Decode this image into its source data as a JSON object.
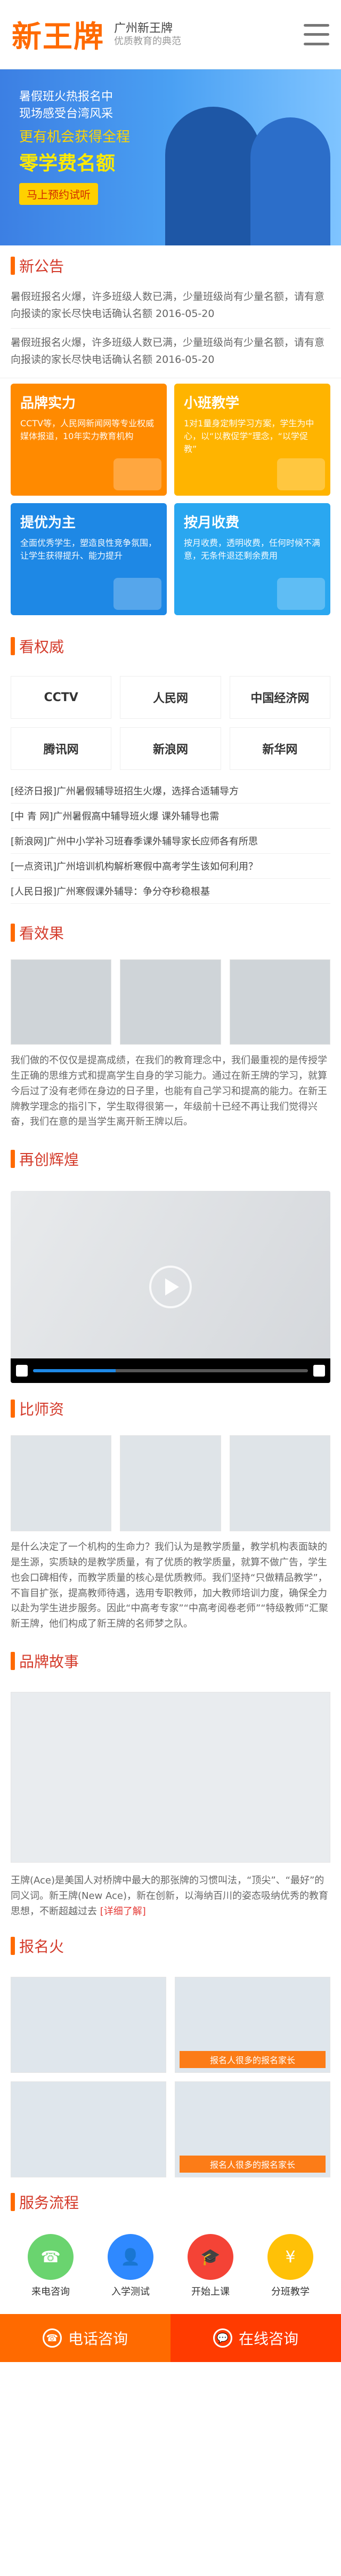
{
  "header": {
    "logo_main": "新王牌",
    "logo_line1": "广州新王牌",
    "logo_line2": "优质教育的典范"
  },
  "banner": {
    "line1": "暑假班火热报名中",
    "line2": "现场感受台湾风采",
    "line3": "更有机会获得全程",
    "headline": "零学费名额",
    "cta": "马上预约试听"
  },
  "notice": {
    "title": "新公告",
    "items": [
      "暑假班报名火爆，许多班级人数已满，少量班级尚有少量名额，请有意向报读的家长尽快电话确认名额   2016-05-20",
      "暑假班报名火爆，许多班级人数已满，少量班级尚有少量名额，请有意向报读的家长尽快电话确认名额   2016-05-20"
    ]
  },
  "features": [
    {
      "title": "品牌实力",
      "desc": "CCTV等，人民网新闻网等专业权威媒体报道，10年实力教育机构",
      "color": "orange"
    },
    {
      "title": "小班教学",
      "desc": "1对1量身定制学习方案，学生为中心，以“以教促学”理念，“以学促教”",
      "color": "yellow"
    },
    {
      "title": "提优为主",
      "desc": "全面优秀学生，塑造良性竞争氛围，让学生获得提升、能力提升",
      "color": "blue"
    },
    {
      "title": "按月收费",
      "desc": "按月收费，透明收费，任何时候不满意，无条件退还剩余费用",
      "color": "lblue"
    }
  ],
  "authority": {
    "title": "看权威",
    "logos": [
      "CCTV",
      "人民网",
      "中国经济网",
      "腾讯网",
      "新浪网",
      "新华网"
    ],
    "news": [
      "[经济日报]广州暑假辅导班招生火爆，选择合适辅导方",
      "[中 青 网]广州暑假高中辅导班火爆 课外辅导也需",
      "[新浪网]广州中小学补习班春季课外辅导家长应师各有所思",
      "[一点资讯]广州培训机构解析寒假中高考学生该如何利用？",
      "[人民日报]广州寒假课外辅导：争分夺秒稳根基"
    ]
  },
  "effect": {
    "title": "看效果",
    "desc": "我们做的不仅仅是提高成绩，在我们的教育理念中，我们最重视的是传授学生正确的思维方式和提高学生自身的学习能力。通过在新王牌的学习，就算今后过了没有老师在身边的日子里，也能有自己学习和提高的能力。在新王牌教学理念的指引下，学生取得很第一，年级前十已经不再让我们觉得兴奋，我们在意的是当学生离开新王牌以后。"
  },
  "video": {
    "title": "再创辉煌"
  },
  "teachers": {
    "title": "比师资",
    "desc": "是什么决定了一个机构的生命力？我们认为是教学质量，教学机构表面缺的是生源，实质缺的是教学质量，有了优质的教学质量，就算不做广告，学生也会口碑相传，而教学质量的核心是优质教师。我们坚持“只做精品教学”，不盲目扩张，提高教师待遇，选用专职教师，加大教师培训力度，确保全力以赴为学生进步服务。因此“中高考专家”“中高考阅卷老师”“特级教师”汇聚新王牌，他们构成了新王牌的名师梦之队。"
  },
  "story": {
    "title": "品牌故事",
    "text": "王牌(Ace)是美国人对桥牌中最大的那张牌的习惯叫法，“顶尖”、“最好”的同义词。新王牌(New Ace)，新在创新，以海纳百川的姿态吸纳优秀的教育思想，不断超越过去",
    "more": "[详细了解]"
  },
  "enroll": {
    "title": "报名火",
    "captions": [
      "",
      "报名人很多的报名家长",
      "",
      "报名人很多的报名家长"
    ]
  },
  "process": {
    "title": "服务流程",
    "steps": [
      "来电咨询",
      "入学测试",
      "开始上课",
      "分班教学"
    ]
  },
  "bottom": {
    "tel": "电话咨询",
    "online": "在线咨询"
  }
}
